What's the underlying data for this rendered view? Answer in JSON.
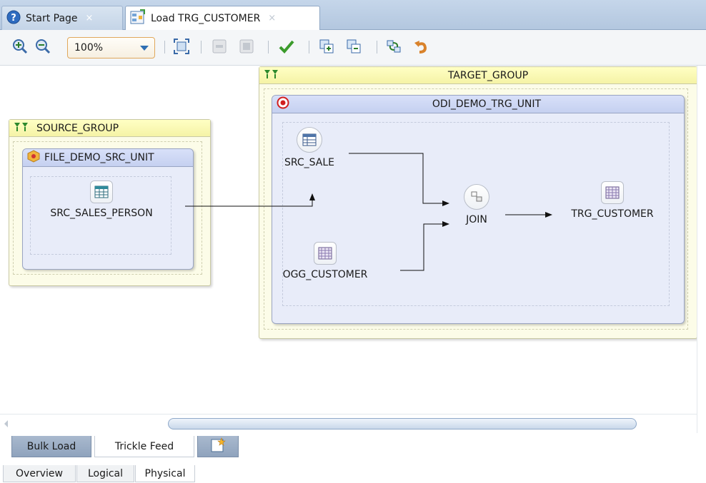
{
  "tabs": {
    "start_page": {
      "label": "Start Page",
      "icon": "help-icon"
    },
    "load": {
      "label": "Load TRG_CUSTOMER",
      "icon": "mapping-icon"
    },
    "close_glyph": "×"
  },
  "toolbar": {
    "zoom_value": "100%",
    "buttons": [
      "zoom-in-icon",
      "zoom-out-icon",
      "fit-to-window-icon",
      "collapse-icon",
      "expand-icon",
      "validate-icon",
      "copy-icon",
      "paste-icon",
      "refresh-icon",
      "undo-icon"
    ]
  },
  "canvas": {
    "source_group": {
      "title": "SOURCE_GROUP",
      "unit": {
        "title": "FILE_DEMO_SRC_UNIT",
        "nodes": {
          "src_sales_person": "SRC_SALES_PERSON"
        }
      }
    },
    "target_group": {
      "title": "TARGET_GROUP",
      "unit": {
        "title": "ODI_DEMO_TRG_UNIT",
        "nodes": {
          "src_sale": "SRC_SALE",
          "ogg_customer": "OGG_CUSTOMER",
          "join": "JOIN",
          "trg_customer": "TRG_CUSTOMER"
        }
      }
    }
  },
  "mode_tabs": {
    "bulk": "Bulk Load",
    "trickle": "Trickle Feed",
    "new_icon": "new-deployment-icon"
  },
  "view_tabs": {
    "overview": "Overview",
    "logical": "Logical",
    "physical": "Physical"
  },
  "colors": {
    "group_fill": "#fcfce8",
    "group_header": "#f5f3a6",
    "unit_fill": "#e8ecf9",
    "unit_header": "#c5d0f0",
    "active_tab": "#ffffff"
  }
}
